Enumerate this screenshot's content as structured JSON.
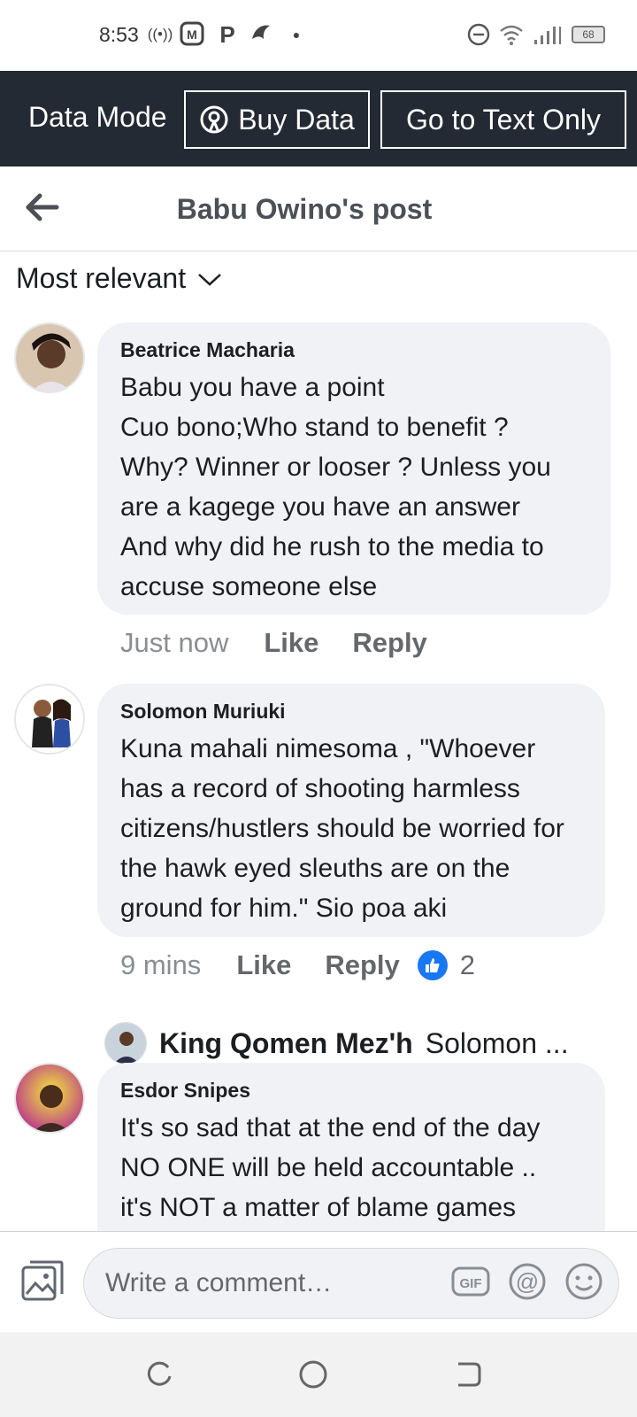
{
  "status_bar": {
    "time": "8:53",
    "battery": "68"
  },
  "data_banner": {
    "mode_label": "Data Mode",
    "buy_label": "Buy Data",
    "text_only_label": "Go to Text Only"
  },
  "header": {
    "title": "Babu Owino's post"
  },
  "sort": {
    "label": "Most relevant"
  },
  "comments": [
    {
      "author": "Beatrice Macharia",
      "text": "Babu you have a point\nCuo bono;Who stand to benefit ?\nWhy? Winner or looser ? Unless you are a kagege you have an answer\nAnd why did he rush to the media to accuse someone else",
      "time": "Just now",
      "like_label": "Like",
      "reply_label": "Reply"
    },
    {
      "author": "Solomon Muriuki",
      "text": "Kuna mahali nimesoma , \"Whoever has a record of shooting harmless citizens/hustlers should be worried for the hawk eyed sleuths are on the ground for him.\" Sio poa aki",
      "time": "9 mins",
      "like_label": "Like",
      "reply_label": "Reply",
      "reaction_count": "2",
      "reply_preview": {
        "name": "King Qomen Mez'h",
        "snippet": "Solomon ..."
      }
    },
    {
      "author": "Esdor Snipes",
      "text": "It's so sad that at the end of the day NO ONE will be held accountable ..\nit's NOT a matter of blame games"
    }
  ],
  "composer": {
    "placeholder": "Write a comment…"
  },
  "colors": {
    "banner_bg": "#242a33",
    "bubble_bg": "#f0f2f5",
    "like_blue": "#1877f2"
  }
}
